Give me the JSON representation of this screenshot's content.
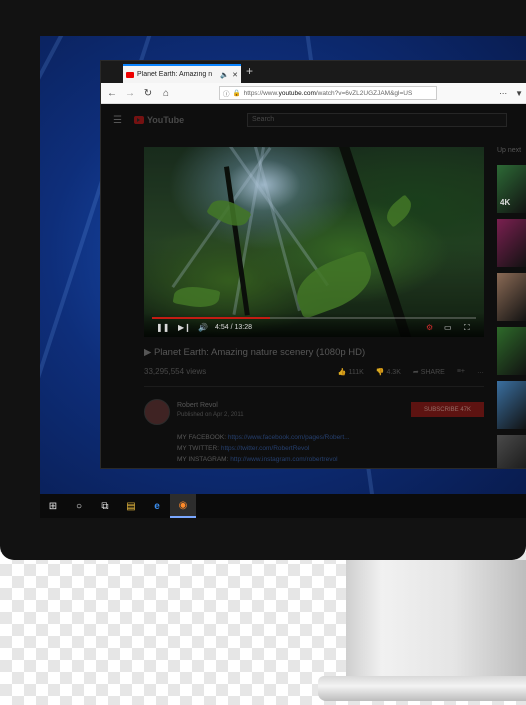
{
  "browser": {
    "tab_title": "Planet Earth: Amazing n",
    "new_tab_label": "+",
    "url_prefix": "https://www.",
    "url_host": "youtube.com",
    "url_path": "/watch?v=6vZL2UGZJAM&gl=US"
  },
  "youtube": {
    "logo_text": "YouTube",
    "search_placeholder": "Search",
    "up_next_label": "Up next",
    "video": {
      "title": "▶ Planet Earth: Amazing nature scenery (1080p HD)",
      "views": "33,295,554 views",
      "time_current": "4:54",
      "time_separator": "/",
      "time_total": "13:28",
      "progress_fraction": 0.364,
      "likes": "111K",
      "dislikes": "4.3K",
      "share_label": "SHARE",
      "more_label": "…"
    },
    "channel": {
      "name": "Robert Revol",
      "published": "Published on Apr 2, 2011",
      "subscribe_label": "SUBSCRIBE",
      "subscriber_count": "47K"
    },
    "description": [
      {
        "label": "MY FACEBOOK: ",
        "link": "https://www.facebook.com/pages/Robert..."
      },
      {
        "label": "MY TWITTER: ",
        "link": "https://twitter.com/RobertRevol"
      },
      {
        "label": "MY INSTAGRAM: ",
        "link": "http://www.instagram.com/robertrevol"
      }
    ],
    "sidebar_thumbs": [
      {
        "badge": "4K",
        "color": "#2d6a36"
      },
      {
        "badge": "",
        "color": "#7a2050"
      },
      {
        "badge": "",
        "color": "#8a6a55"
      },
      {
        "badge": "",
        "color": "#2e6a2a"
      },
      {
        "badge": "",
        "color": "#3a6fa0"
      },
      {
        "badge": "",
        "color": "#4a4a4a"
      }
    ]
  },
  "taskbar": {
    "icons": [
      {
        "name": "windows-start-icon",
        "glyph": "⊞"
      },
      {
        "name": "cortana-icon",
        "glyph": "○"
      },
      {
        "name": "task-view-icon",
        "glyph": "⧉"
      },
      {
        "name": "file-explorer-icon",
        "glyph": "▤"
      },
      {
        "name": "edge-icon",
        "glyph": "e"
      },
      {
        "name": "firefox-icon",
        "glyph": "◉"
      }
    ]
  }
}
